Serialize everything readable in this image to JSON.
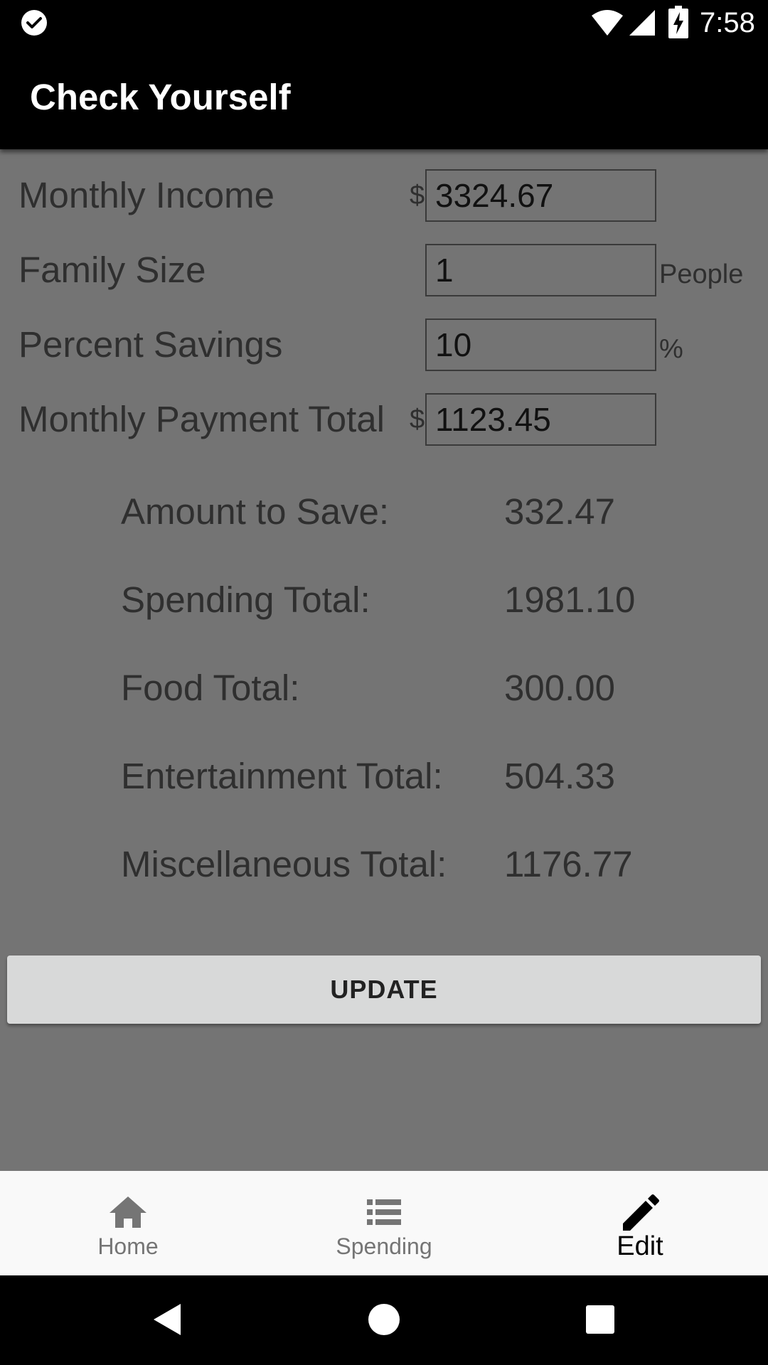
{
  "status_bar": {
    "time": "7:58",
    "icons": [
      "check-circle-icon",
      "wifi-icon",
      "signal-icon",
      "battery-charging-icon"
    ]
  },
  "app_bar": {
    "title": "Check Yourself"
  },
  "form": {
    "monthly_income": {
      "label": "Monthly Income",
      "currency": "$",
      "value": "3324.67"
    },
    "family_size": {
      "label": "Family Size",
      "value": "1",
      "unit": "People"
    },
    "percent_savings": {
      "label": "Percent Savings",
      "value": "10",
      "unit": "%"
    },
    "monthly_payment_total": {
      "label": "Monthly Payment Total",
      "currency": "$",
      "value": "1123.45"
    }
  },
  "summary": {
    "amount_to_save": {
      "label": "Amount to Save:",
      "value": "332.47"
    },
    "spending_total": {
      "label": "Spending Total:",
      "value": "1981.10"
    },
    "food_total": {
      "label": "Food Total:",
      "value": "300.00"
    },
    "entertainment_total": {
      "label": "Entertainment Total:",
      "value": "504.33"
    },
    "miscellaneous_total": {
      "label": "Miscellaneous Total:",
      "value": "1176.77"
    }
  },
  "update_button": {
    "label": "UPDATE"
  },
  "bottom_nav": {
    "items": [
      {
        "label": "Home",
        "icon": "home-icon",
        "active": false
      },
      {
        "label": "Spending",
        "icon": "list-icon",
        "active": false
      },
      {
        "label": "Edit",
        "icon": "pencil-icon",
        "active": true
      }
    ]
  },
  "system_nav": {
    "icons": [
      "back-icon",
      "home-circle-icon",
      "recents-icon"
    ]
  },
  "colors": {
    "content_background": "#747474",
    "bar_background": "#000000",
    "nav_background": "#f9f9f9",
    "button_background": "#d8d9d9",
    "text_dark": "#2f2f2f",
    "nav_inactive": "#757575"
  }
}
